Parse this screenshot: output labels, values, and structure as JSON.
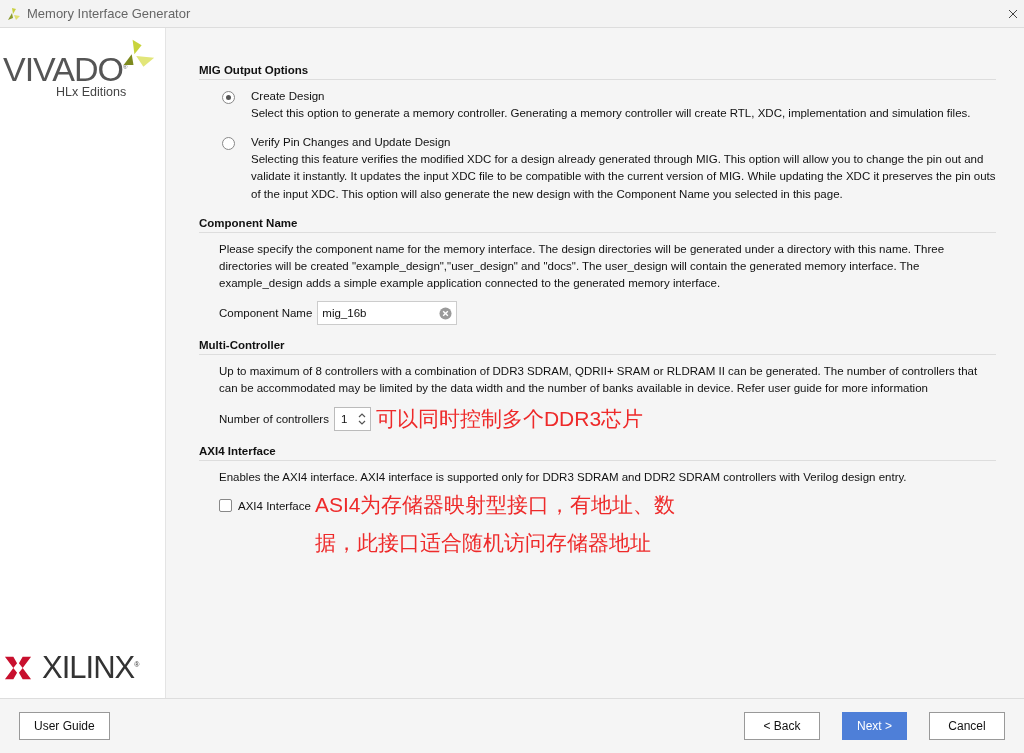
{
  "window": {
    "title": "Memory Interface Generator"
  },
  "sidebar": {
    "logo_top": "VIVADO$^{®}$",
    "logo_sub": "HLx Editions",
    "logo_bottom": "XILINX$^{®}$"
  },
  "sections": [
    {
      "heading": "MIG Output Options",
      "kind": "radios",
      "options": [
        {
          "label": "Create Design",
          "description": "Select this option to generate a memory controller. Generating a memory controller will create RTL, XDC, implementation and simulation files.",
          "selected": true
        },
        {
          "label": "Verify Pin Changes and Update Design",
          "description": "Selecting this feature verifies the modified XDC for a design already generated through MIG. This option will allow you to change the pin out and validate it instantly. It updates the input XDC file to be compatible with the current version of MIG. While updating the XDC it preserves the pin outs of the input XDC. This option will also generate the new design with the Component Name you selected in this page.",
          "selected": false
        }
      ]
    },
    {
      "heading": "Component Name",
      "kind": "field",
      "description": "Please specify the component name for the memory interface. The design directories will be generated under a directory with this name. Three directories will be created \"example_design\",\"user_design\" and \"docs\". The user_design will contain the generated memory interface. The example_design adds a simple example application connected to the generated memory interface.",
      "field": {
        "label": "Component Name",
        "value": "mig_16b"
      }
    },
    {
      "heading": "Multi-Controller",
      "kind": "spinner",
      "description": "Up to maximum of 8 controllers with a combination of DDR3 SDRAM, QDRII+ SRAM or RLDRAM II can be generated. The number of controllers that can be accommodated may be limited by the data width and the number of banks available in device. Refer user guide for more information",
      "spinner": {
        "label": "Number of controllers",
        "value": "1"
      },
      "annotation": [
        "可以同时控制多个DDR3芯片"
      ]
    },
    {
      "heading": "AXI4 Interface",
      "kind": "checkbox",
      "description": "Enables the AXI4 interface. AXI4 interface is supported only for DDR3 SDRAM and DDR2 SDRAM controllers with Verilog design entry.",
      "checkbox": {
        "label": "AXI4 Interface",
        "checked": false
      },
      "annotation": [
        "ASI4为存储器映射型接口，有地址、数",
        "据，此接口适合随机访问存储器地址"
      ]
    }
  ],
  "buttons": {
    "left": [
      {
        "label": "User Guide",
        "primary": false
      }
    ],
    "right": [
      {
        "label": "< Back",
        "primary": false
      },
      {
        "label": "Next >",
        "primary": true
      },
      {
        "label": "Cancel",
        "primary": false
      }
    ]
  }
}
